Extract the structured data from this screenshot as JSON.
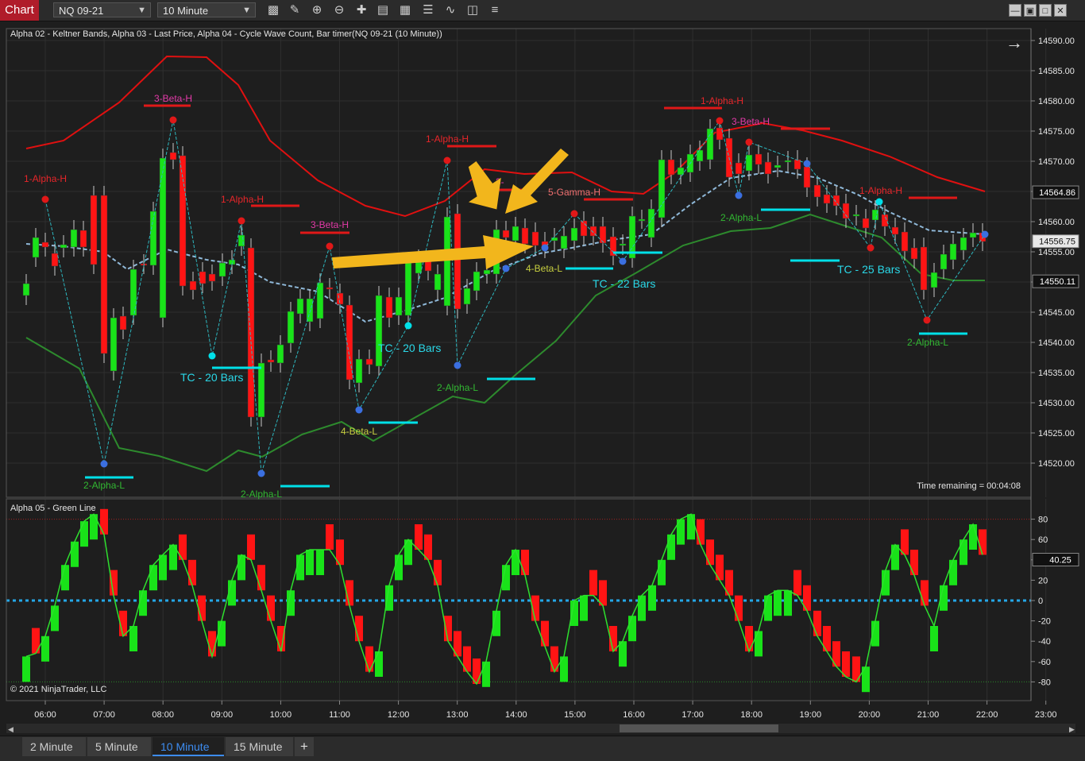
{
  "toolbar": {
    "chart_tab": "Chart",
    "instrument": "NQ 09-21",
    "interval": "10 Minute",
    "tools": [
      "bar-chart-icon",
      "draw-pencil-icon",
      "zoom-in-icon",
      "zoom-out-icon",
      "crosshair-icon",
      "data-box-icon",
      "indicators-icon",
      "strategies-icon",
      "properties-icon",
      "more-icon"
    ]
  },
  "window_buttons": [
    "minimize-icon",
    "restore-icon",
    "maximize-icon",
    "close-icon"
  ],
  "colors": {
    "background": "#1e1e1e",
    "up_bar": "#19e319",
    "down_bar": "#ff1414",
    "upper_band": "#e01010",
    "lower_band": "#2d8a2d",
    "mid_band": "#8fb8d8",
    "arrow": "#f2b61c",
    "cyan": "#00e0e8"
  },
  "price_panel": {
    "title": "Alpha 02 - Keltner Bands, Alpha 03 - Last Price, Alpha 04 - Cycle Wave Count, Bar timer(NQ 09-21 (10 Minute))",
    "price_ticks": [
      "14590.00",
      "14585.00",
      "14580.00",
      "14575.00",
      "14570.00",
      "14565.00",
      "14560.00",
      "14555.00",
      "14550.00",
      "14545.00",
      "14540.00",
      "14535.00",
      "14530.00",
      "14525.00",
      "14520.00"
    ],
    "price_markers": [
      {
        "label": "14564.86",
        "style": "dark"
      },
      {
        "label": "14556.75",
        "style": "light"
      },
      {
        "label": "14550.11",
        "style": "dark"
      }
    ],
    "timer_text": "Time remaining = 00:04:08",
    "labels": [
      {
        "text": "1-Alpha-H",
        "kind": "alpha_h"
      },
      {
        "text": "3-Beta-H",
        "kind": "beta_h"
      },
      {
        "text": "1-Alpha-H",
        "kind": "alpha_h"
      },
      {
        "text": "3-Beta-H",
        "kind": "beta_h"
      },
      {
        "text": "1-Alpha-H",
        "kind": "alpha_h"
      },
      {
        "text": "3-",
        "kind": "beta_h"
      },
      {
        "text": "5-Gamma-H",
        "kind": "gamma_h"
      },
      {
        "text": "1-Alpha-H",
        "kind": "alpha_h"
      },
      {
        "text": "3-Beta-H",
        "kind": "beta_h"
      },
      {
        "text": "1-Alpha-H",
        "kind": "alpha_h"
      },
      {
        "text": "2-Alpha-L",
        "kind": "alpha_l"
      },
      {
        "text": "2-Alpha-L",
        "kind": "alpha_l"
      },
      {
        "text": "4-Beta-L",
        "kind": "beta_l"
      },
      {
        "text": "2-Alpha-L",
        "kind": "alpha_l"
      },
      {
        "text": "4-Beta-L",
        "kind": "beta_l"
      },
      {
        "text": "2-Alpha-L",
        "kind": "alpha_l"
      },
      {
        "text": "2-Alpha-L",
        "kind": "alpha_l"
      },
      {
        "text": "TC - 20 Bars",
        "kind": "tc"
      },
      {
        "text": "TC - 20 Bars",
        "kind": "tc"
      },
      {
        "text": "TC - 22 Bars",
        "kind": "tc"
      },
      {
        "text": "TC - 25 Bars",
        "kind": "tc"
      }
    ]
  },
  "oscillator_panel": {
    "title": "Alpha 05 - Green Line",
    "ticks": [
      "80",
      "60",
      "40",
      "20",
      "0",
      "-20",
      "-40",
      "-60",
      "-80"
    ],
    "value_marker": "40.25",
    "copyright": "© 2021 NinjaTrader, LLC"
  },
  "time_axis": [
    "06:00",
    "07:00",
    "08:00",
    "09:00",
    "10:00",
    "11:00",
    "12:00",
    "13:00",
    "14:00",
    "15:00",
    "16:00",
    "17:00",
    "18:00",
    "19:00",
    "20:00",
    "21:00",
    "22:00",
    "23:00"
  ],
  "bottom_tabs": [
    "2 Minute",
    "5 Minute",
    "10 Minute",
    "15 Minute"
  ],
  "active_tab": "10 Minute",
  "add_tab_label": "+"
}
